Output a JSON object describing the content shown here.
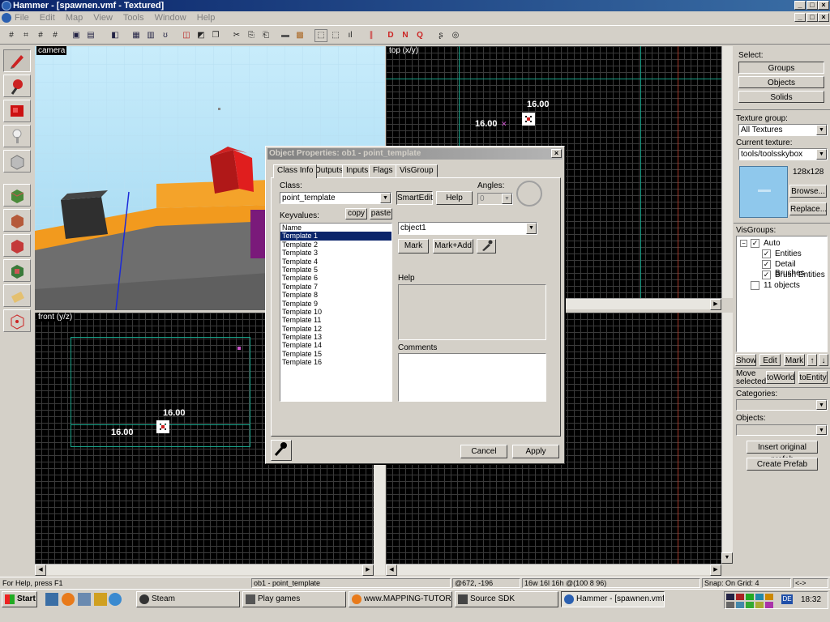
{
  "window": {
    "title": "Hammer - [spawnen.vmf - Textured]"
  },
  "menu": [
    "File",
    "Edit",
    "Map",
    "View",
    "Tools",
    "Window",
    "Help"
  ],
  "toolbar": {
    "icons": [
      "grid-icon",
      "grid-3d-icon",
      "grid-small-icon",
      "grid-large-icon",
      "group-icon",
      "ungroup-icon",
      "hide-icon",
      "carve-icon",
      "hollow-icon",
      "vertex-icon",
      "flip-icon",
      "rotate-icon",
      "copy-icon",
      "cut-icon",
      "paste-icon",
      "undo-icon",
      "redo-icon",
      "texture-lock-icon",
      "texture-browse-icon",
      "select-icon",
      "entity-icon",
      "compile-icon",
      "run-icon",
      "visgroup-icon",
      "face-icon",
      "settings-icon"
    ]
  },
  "viewports": {
    "camera": {
      "label": "camera"
    },
    "top": {
      "label": "top (x/y)",
      "dim_x": "16.00",
      "dim_y": "16.00"
    },
    "front": {
      "label": "front (y/z)",
      "dim_x": "16.00",
      "dim_y": "16.00"
    }
  },
  "right_panel": {
    "select_label": "Select:",
    "select_buttons": [
      "Groups",
      "Objects",
      "Solids"
    ],
    "texture_group_label": "Texture group:",
    "texture_group_value": "All Textures",
    "current_texture_label": "Current texture:",
    "current_texture_value": "tools/toolsskybox",
    "texture_size": "128x128",
    "browse": "Browse...",
    "replace": "Replace...",
    "visgroups_label": "VisGroups:",
    "visgroups": [
      {
        "label": "Auto",
        "checked": true,
        "level": 0
      },
      {
        "label": "Entities",
        "checked": true,
        "level": 1
      },
      {
        "label": "Detail Brushes",
        "checked": true,
        "level": 1
      },
      {
        "label": "Brush Entities",
        "checked": true,
        "level": 1
      },
      {
        "label": "11 objects",
        "checked": false,
        "level": 0
      }
    ],
    "vis_buttons": [
      "Show",
      "Edit",
      "Mark"
    ],
    "move_selected": "Move selected:",
    "to_world": "toWorld",
    "to_entity": "toEntity",
    "categories_label": "Categories:",
    "objects_label": "Objects:",
    "insert_prefab": "Insert original prefab",
    "create_prefab": "Create Prefab"
  },
  "dialog": {
    "title": "Object Properties: ob1 - point_template",
    "tabs": [
      "Class Info",
      "Outputs",
      "Inputs",
      "Flags",
      "VisGroup"
    ],
    "class_label": "Class:",
    "class_value": "point_template",
    "smartedit": "SmartEdit",
    "help": "Help",
    "angles_label": "Angles:",
    "angles_value": "0",
    "keyvalues_label": "Keyvalues:",
    "copy": "copy",
    "paste": "paste",
    "keyvalues": [
      "Name",
      "Template 1",
      "Template 2",
      "Template 3",
      "Template 4",
      "Template 5",
      "Template 6",
      "Template 7",
      "Template 8",
      "Template 9",
      "Template 10",
      "Template 11",
      "Template 12",
      "Template 13",
      "Template 14",
      "Template 15",
      "Template 16"
    ],
    "selected_index": 1,
    "value_combo": "cbject1",
    "mark": "Mark",
    "mark_add": "Mark+Add",
    "help_label": "Help",
    "comments_label": "Comments",
    "cancel": "Cancel",
    "apply": "Apply"
  },
  "status": {
    "help": "For Help, press F1",
    "object": "ob1 - point_template",
    "coords": "@672, -196",
    "size": "16w 16l 16h @(100 8 96)",
    "snap": "Snap: On Grid: 4",
    "arrows": "<->"
  },
  "taskbar": {
    "start": "Start",
    "tasks": [
      {
        "label": "Steam",
        "icon": "steam-icon"
      },
      {
        "label": "Play games",
        "icon": "game-icon"
      },
      {
        "label": "www.MAPPING-TUTORIA...",
        "icon": "firefox-icon"
      },
      {
        "label": "Source SDK",
        "icon": "sdk-icon"
      },
      {
        "label": "Hammer - [spawnen.vmf ...",
        "icon": "hammer-icon"
      }
    ],
    "clock": "18:32",
    "lang": "DE"
  },
  "colors": {
    "selection": "#0a246a",
    "grid_highlight": "#19a38a",
    "axis": "#a33a2a"
  }
}
